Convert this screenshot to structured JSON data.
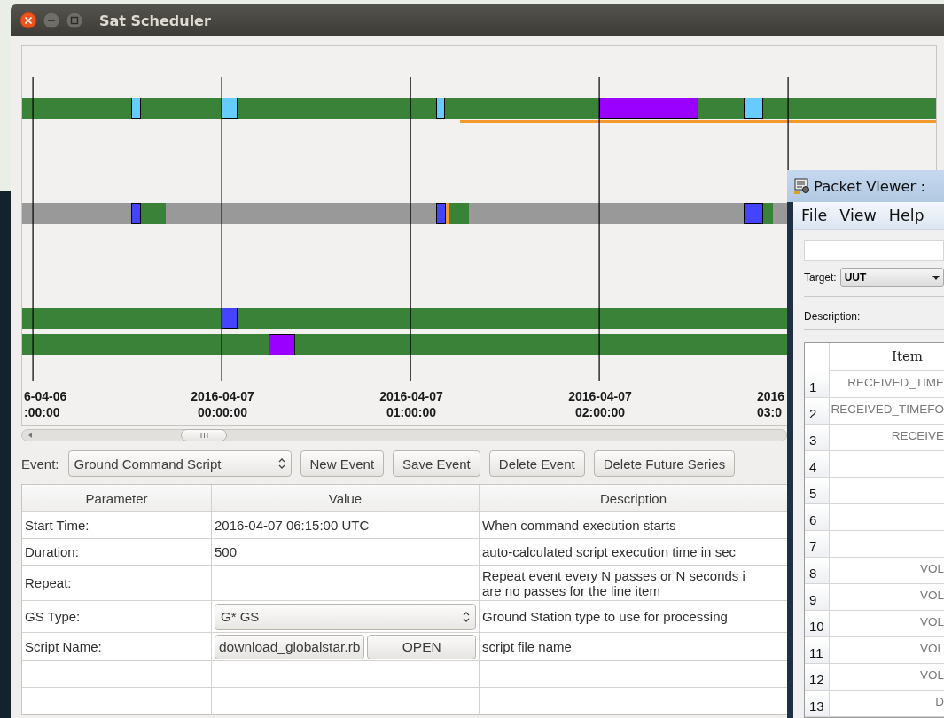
{
  "window": {
    "title": "Sat Scheduler"
  },
  "timeline": {
    "ticks": [
      {
        "date": "6-04-06",
        "time": ":00:00"
      },
      {
        "date": "2016-04-07",
        "time": "00:00:00"
      },
      {
        "date": "2016-04-07",
        "time": "01:00:00"
      },
      {
        "date": "2016-04-07",
        "time": "02:00:00"
      },
      {
        "date": "2016",
        "time": "03:0"
      }
    ],
    "rows": [
      {
        "color": "#3b8239",
        "segments": [
          {
            "kind": "block",
            "color": "#66ccff"
          },
          {
            "kind": "block",
            "color": "#66ccff"
          },
          {
            "kind": "block",
            "color": "#66ccff"
          },
          {
            "kind": "block",
            "color": "#9900ff"
          },
          {
            "kind": "block",
            "color": "#66ccff"
          },
          {
            "kind": "underline",
            "color": "#f39a2a"
          }
        ]
      },
      {
        "color": "#999999",
        "segments": [
          {
            "kind": "fill",
            "color": "#3b8239"
          },
          {
            "kind": "block",
            "color": "#4444ff"
          },
          {
            "kind": "fill",
            "color": "#3b8239"
          },
          {
            "kind": "fill",
            "color": "#f39a2a"
          },
          {
            "kind": "block",
            "color": "#4444ff"
          },
          {
            "kind": "fill",
            "color": "#3b8239"
          },
          {
            "kind": "block",
            "color": "#4444ff"
          }
        ]
      },
      {
        "color": "#3b8239",
        "segments": [
          {
            "kind": "block",
            "color": "#4444ff"
          }
        ]
      },
      {
        "color": "#3b8239",
        "segments": [
          {
            "kind": "block",
            "color": "#9900ff"
          }
        ]
      }
    ]
  },
  "event_bar": {
    "label": "Event:",
    "event_type": "Ground Command Script",
    "buttons": [
      "New Event",
      "Save Event",
      "Delete Event",
      "Delete Future Series"
    ]
  },
  "parameters": {
    "columns": [
      "Parameter",
      "Value",
      "Description"
    ],
    "rows": [
      {
        "kind": "text",
        "parameter": "Start Time:",
        "value": "2016-04-07 06:15:00 UTC",
        "description": "When command execution starts"
      },
      {
        "kind": "text",
        "parameter": "Duration:",
        "value": "500",
        "description": "auto-calculated script execution time in sec"
      },
      {
        "kind": "text",
        "parameter": "Repeat:",
        "description": "Repeat event every N passes or N seconds i\nare no passes for the line item"
      },
      {
        "kind": "select",
        "parameter": "GS Type:",
        "value": "G* GS",
        "description": "Ground Station type to use for processing"
      },
      {
        "kind": "file",
        "parameter": "Script Name:",
        "value": "download_globalstar.rb",
        "button": "OPEN",
        "description": "script file name"
      },
      {
        "kind": "empty"
      },
      {
        "kind": "empty"
      }
    ]
  },
  "packet_viewer": {
    "title": "Packet Viewer :",
    "menu": [
      "File",
      "View",
      "Help"
    ],
    "target_label": "Target:",
    "target": "UUT",
    "description_label": "Description:",
    "columns": [
      "Item"
    ],
    "rows": [
      {
        "number": "1",
        "item": "RECEIVED_TIME"
      },
      {
        "number": "2",
        "item": "RECEIVED_TIMEFO"
      },
      {
        "number": "3",
        "item": "RECEIVE"
      },
      {
        "number": "4"
      },
      {
        "number": "5"
      },
      {
        "number": "6"
      },
      {
        "number": "7"
      },
      {
        "number": "8",
        "item": "VOL"
      },
      {
        "number": "9",
        "item": "VOL"
      },
      {
        "number": "10",
        "item": "VOL"
      },
      {
        "number": "11",
        "item": "VOL"
      },
      {
        "number": "12",
        "item": "VOL"
      },
      {
        "number": "13",
        "item": "D"
      }
    ]
  }
}
